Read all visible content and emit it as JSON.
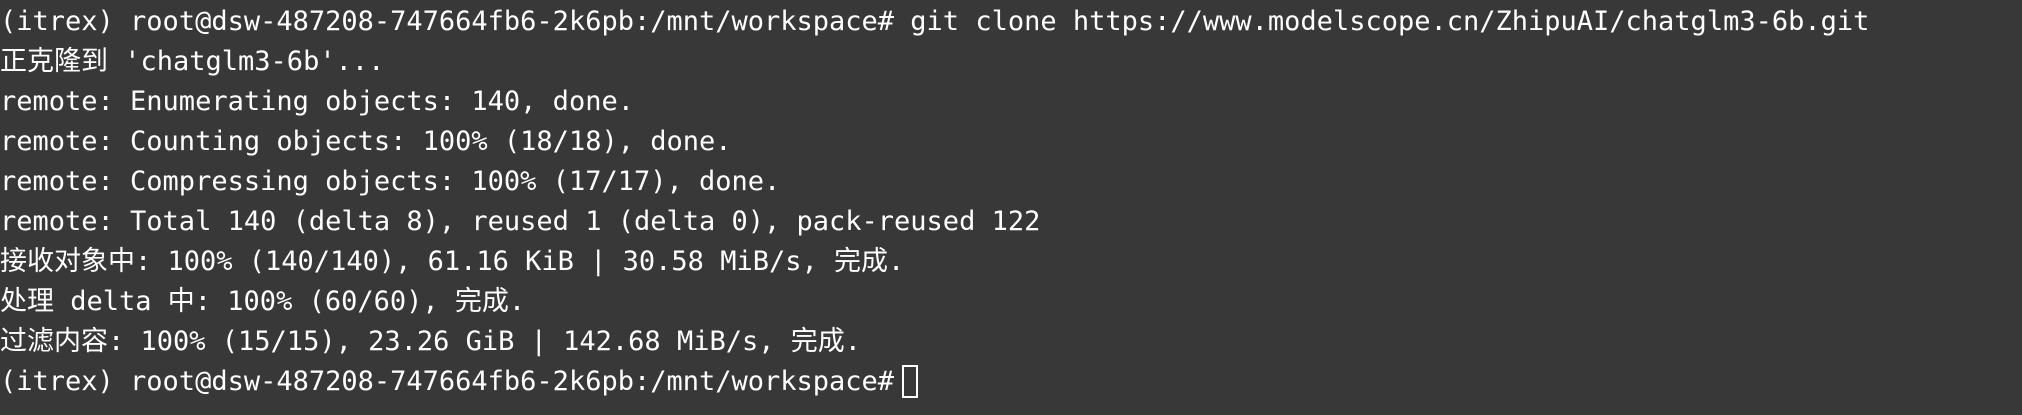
{
  "terminal": {
    "lines": [
      "(itrex) root@dsw-487208-747664fb6-2k6pb:/mnt/workspace# git clone https://www.modelscope.cn/ZhipuAI/chatglm3-6b.git",
      "正克隆到 'chatglm3-6b'...",
      "remote: Enumerating objects: 140, done.",
      "remote: Counting objects: 100% (18/18), done.",
      "remote: Compressing objects: 100% (17/17), done.",
      "remote: Total 140 (delta 8), reused 1 (delta 0), pack-reused 122",
      "接收对象中: 100% (140/140), 61.16 KiB | 30.58 MiB/s, 完成.",
      "处理 delta 中: 100% (60/60), 完成.",
      "过滤内容: 100% (15/15), 23.26 GiB | 142.68 MiB/s, 完成."
    ],
    "prompt": "(itrex) root@dsw-487208-747664fb6-2k6pb:/mnt/workspace#"
  }
}
